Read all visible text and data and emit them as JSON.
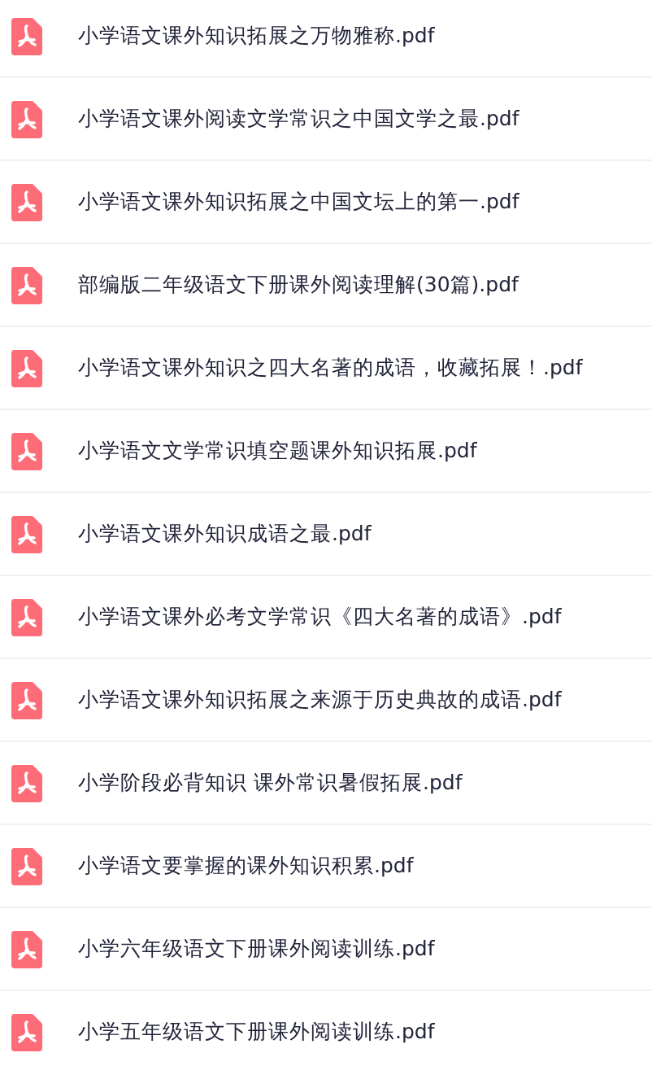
{
  "files": [
    {
      "name": "小学语文课外知识拓展之万物雅称.pdf"
    },
    {
      "name": "小学语文课外阅读文学常识之中国文学之最.pdf"
    },
    {
      "name": "小学语文课外知识拓展之中国文坛上的第一.pdf"
    },
    {
      "name": "部编版二年级语文下册课外阅读理解(30篇).pdf"
    },
    {
      "name": "小学语文课外知识之四大名著的成语，收藏拓展！.pdf"
    },
    {
      "name": "小学语文文学常识填空题课外知识拓展.pdf"
    },
    {
      "name": "小学语文课外知识成语之最.pdf"
    },
    {
      "name": "小学语文课外必考文学常识《四大名著的成语》.pdf"
    },
    {
      "name": "小学语文课外知识拓展之来源于历史典故的成语.pdf"
    },
    {
      "name": "小学阶段必背知识 课外常识暑假拓展.pdf"
    },
    {
      "name": "小学语文要掌握的课外知识积累.pdf"
    },
    {
      "name": "小学六年级语文下册课外阅读训练.pdf"
    },
    {
      "name": "小学五年级语文下册课外阅读训练.pdf"
    }
  ]
}
